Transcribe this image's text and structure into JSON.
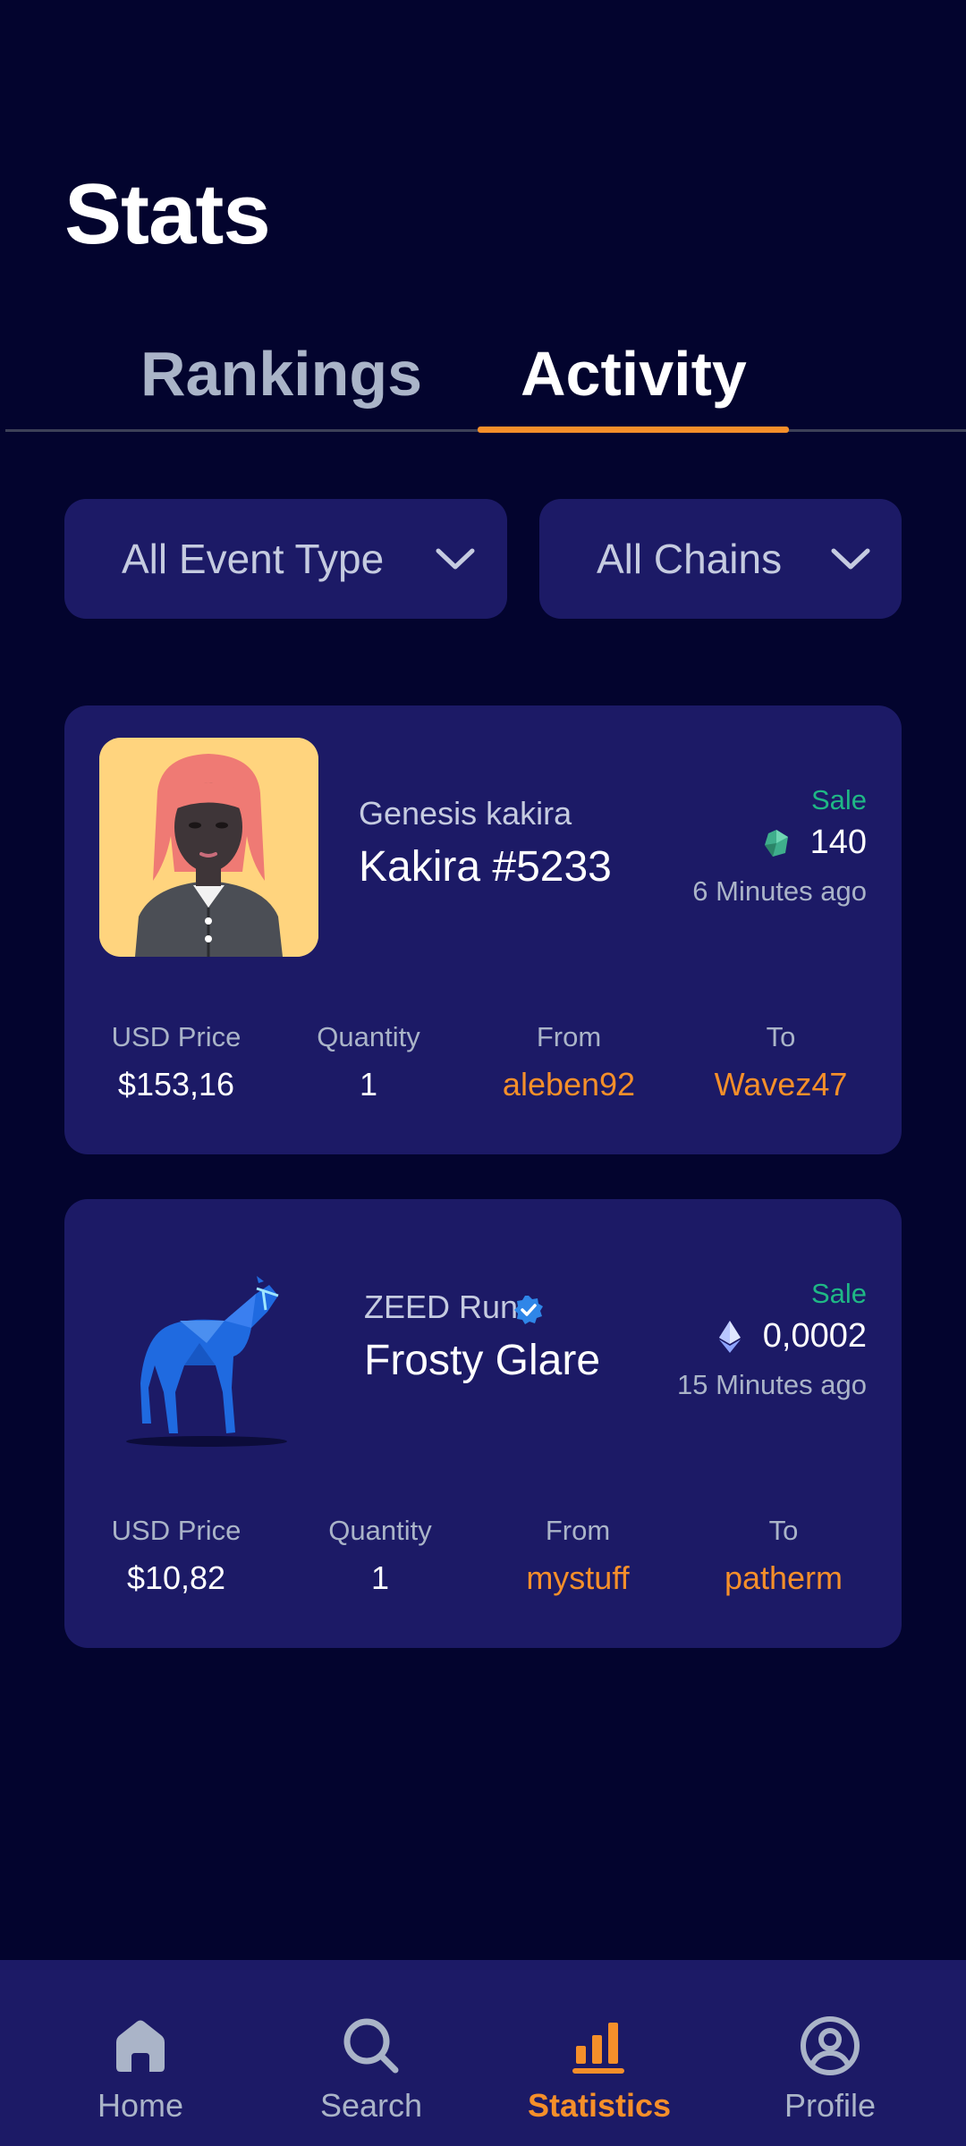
{
  "page": {
    "title": "Stats"
  },
  "tabs": [
    {
      "label": "Rankings",
      "active": false
    },
    {
      "label": "Activity",
      "active": true
    }
  ],
  "filters": {
    "event_type": "All Event Type",
    "chains": "All Chains"
  },
  "activities": [
    {
      "collection": "Genesis kakira",
      "name": "Kakira #5233",
      "verified": false,
      "event": "Sale",
      "chain_icon": "polygon-gem-icon",
      "price": "140",
      "time_ago": "6 Minutes ago",
      "usd_price_label": "USD Price",
      "usd_price": "$153,16",
      "quantity_label": "Quantity",
      "quantity": "1",
      "from_label": "From",
      "from": "aleben92",
      "to_label": "To",
      "to": "Wavez47"
    },
    {
      "collection": "ZEED Run",
      "name": "Frosty Glare",
      "verified": true,
      "event": "Sale",
      "chain_icon": "ethereum-icon",
      "price": "0,0002",
      "time_ago": "15 Minutes ago",
      "usd_price_label": "USD Price",
      "usd_price": "$10,82",
      "quantity_label": "Quantity",
      "quantity": "1",
      "from_label": "From",
      "from": "mystuff",
      "to_label": "To",
      "to": "patherm"
    }
  ],
  "bottom_nav": [
    {
      "label": "Home",
      "icon": "home-icon",
      "active": false
    },
    {
      "label": "Search",
      "icon": "search-icon",
      "active": false
    },
    {
      "label": "Statistics",
      "icon": "bar-chart-icon",
      "active": true
    },
    {
      "label": "Profile",
      "icon": "profile-icon",
      "active": false
    }
  ],
  "colors": {
    "background": "#03042e",
    "card": "#1c1a66",
    "accent": "#f58f2a",
    "sale": "#1fb885",
    "muted": "#aab4c8"
  }
}
